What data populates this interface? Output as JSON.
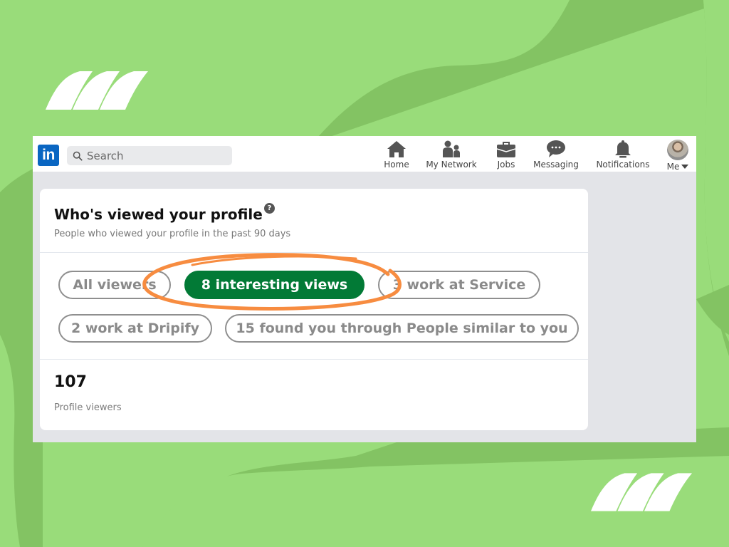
{
  "colors": {
    "background_light": "#99dc7a",
    "background_dark": "#83c363",
    "linkedin_blue": "#0a66c2",
    "active_pill": "#027a36",
    "annotation_orange": "#f78c40"
  },
  "topbar": {
    "logo_text": "in",
    "search": {
      "placeholder": "Search",
      "icon": "search-icon"
    },
    "nav": [
      {
        "label": "Home",
        "icon": "home-icon"
      },
      {
        "label": "My Network",
        "icon": "network-icon"
      },
      {
        "label": "Jobs",
        "icon": "briefcase-icon"
      },
      {
        "label": "Messaging",
        "icon": "chat-icon"
      },
      {
        "label": "Notifications",
        "icon": "bell-icon"
      },
      {
        "label": "Me",
        "icon": "avatar"
      }
    ]
  },
  "card": {
    "title": "Who's viewed your profile",
    "help_icon": "?",
    "subtitle": "People who viewed your profile in the past 90 days",
    "filters": [
      {
        "label": "All viewers",
        "active": false
      },
      {
        "label": "8 interesting views",
        "active": true
      },
      {
        "label": "3 work at Service",
        "active": false
      },
      {
        "label": "2 work at Dripify",
        "active": false
      },
      {
        "label": "15 found you through People similar to you",
        "active": false
      }
    ],
    "stat": {
      "value": "107",
      "label": "Profile viewers"
    }
  }
}
